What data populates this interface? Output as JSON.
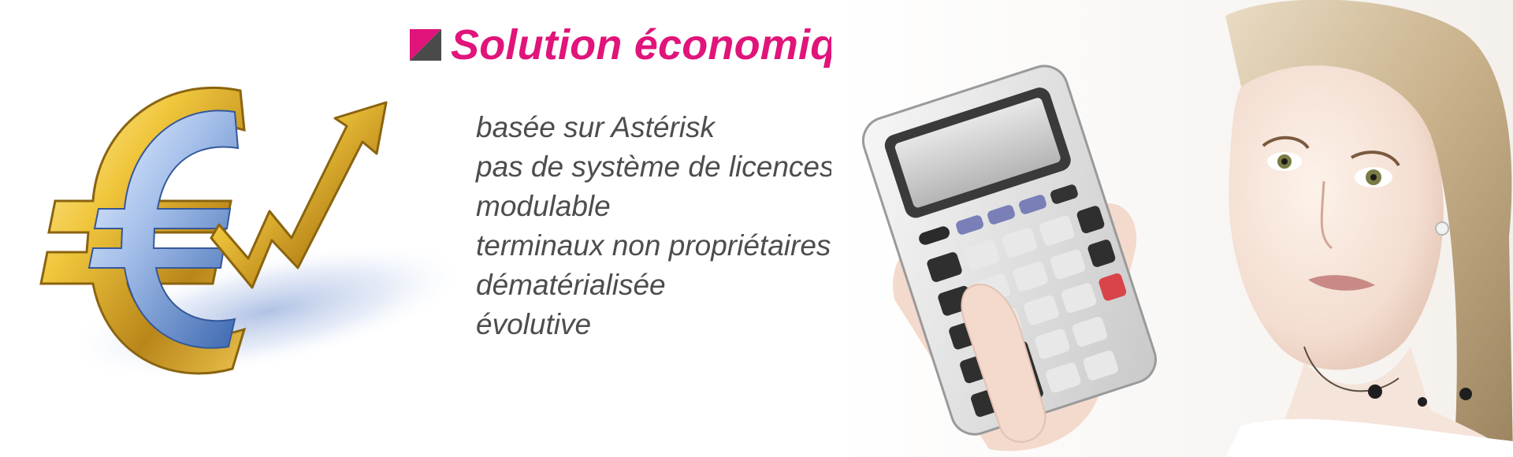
{
  "heading": {
    "text": "Solution économique !",
    "icon": "pink-gray-diagonal-square-icon"
  },
  "features": [
    "basée sur Astérisk",
    "pas de système de licences",
    "modulable",
    "terminaux non propriétaires",
    "dématérialisée",
    "évolutive"
  ],
  "illustrations": {
    "left": "euro-symbol-with-rising-arrow-illustration",
    "right": "woman-holding-calculator-photo"
  },
  "colors": {
    "heading": "#e0147a",
    "icon_pink": "#e0147a",
    "icon_gray": "#4a4a4a",
    "body_text": "#4d4d4d",
    "euro_gold": "#d8a623",
    "euro_blue": "#4f7fc0"
  }
}
